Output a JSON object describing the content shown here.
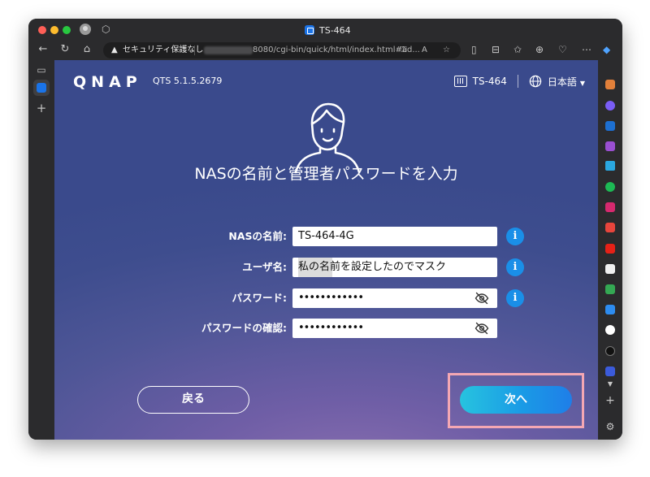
{
  "browser": {
    "tab_title": "TS-464",
    "url_security": "セキュリティ保護なし",
    "url_visible": "8080/cgi-bin/quick/html/index.html#ad..."
  },
  "header": {
    "brand": [
      "Q",
      "N",
      "A",
      "P"
    ],
    "version": "QTS 5.1.5.2679",
    "device_name": "TS-464",
    "language": "日本語"
  },
  "page": {
    "title": "NASの名前と管理者パスワードを入力"
  },
  "form": {
    "nas_name_label": "NASの名前:",
    "nas_name_value": "TS-464-4G",
    "user_name_label": "ユーザ名:",
    "user_name_value": "私の名前を設定したのでマスク",
    "password_label": "パスワード:",
    "password_value": "••••••••••••",
    "confirm_label": "パスワードの確認:",
    "confirm_value": "••••••••••••",
    "info_glyph": "i"
  },
  "buttons": {
    "back": "戻る",
    "next": "次へ"
  },
  "colors": {
    "accent": "#1a8fe8",
    "next_gradient_start": "#27c3df",
    "next_gradient_end": "#1f7ee8",
    "highlight": "#f4a7b3"
  }
}
